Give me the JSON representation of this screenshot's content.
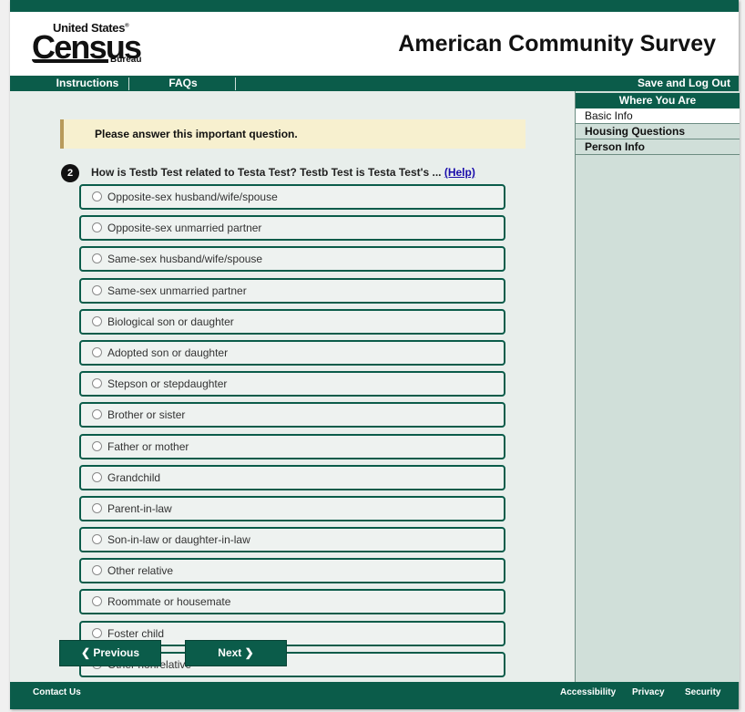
{
  "logo": {
    "line1": "United States",
    "reg": "®",
    "line2": "Census",
    "line3": "Bureau"
  },
  "header": {
    "title": "American Community Survey"
  },
  "nav": {
    "instructions": "Instructions",
    "faqs": "FAQs",
    "save_logout": "Save and Log Out"
  },
  "sidebar": {
    "title": "Where You Are",
    "items": [
      {
        "label": "Basic Info"
      },
      {
        "label": "Housing Questions"
      },
      {
        "label": "Person Info"
      }
    ]
  },
  "alert": {
    "text": "Please answer this important question."
  },
  "question": {
    "number": "2",
    "text": "How is Testb Test related to Testa Test? Testb Test is Testa Test's ...",
    "help": "(Help)",
    "options": [
      {
        "label": "Opposite-sex husband/wife/spouse"
      },
      {
        "label": "Opposite-sex unmarried partner"
      },
      {
        "label": "Same-sex husband/wife/spouse"
      },
      {
        "label": "Same-sex unmarried partner"
      },
      {
        "label": "Biological son or daughter"
      },
      {
        "label": "Adopted son or daughter"
      },
      {
        "label": "Stepson or stepdaughter"
      },
      {
        "label": "Brother or sister"
      },
      {
        "label": "Father or mother"
      },
      {
        "label": "Grandchild"
      },
      {
        "label": "Parent-in-law"
      },
      {
        "label": "Son-in-law or daughter-in-law"
      },
      {
        "label": "Other relative"
      },
      {
        "label": "Roommate or housemate"
      },
      {
        "label": "Foster child"
      },
      {
        "label": "Other nonrelative"
      }
    ]
  },
  "buttons": {
    "previous": "Previous",
    "next": "Next",
    "prev_icon": "chevron-left",
    "next_icon": "chevron-right"
  },
  "footer": {
    "contact": "Contact Us",
    "accessibility": "Accessibility",
    "privacy": "Privacy",
    "security": "Security"
  },
  "colors": {
    "brand": "#0b5c4a",
    "alert_bg": "#f7f0cf",
    "sidebar_bg": "#d0dfd9"
  }
}
